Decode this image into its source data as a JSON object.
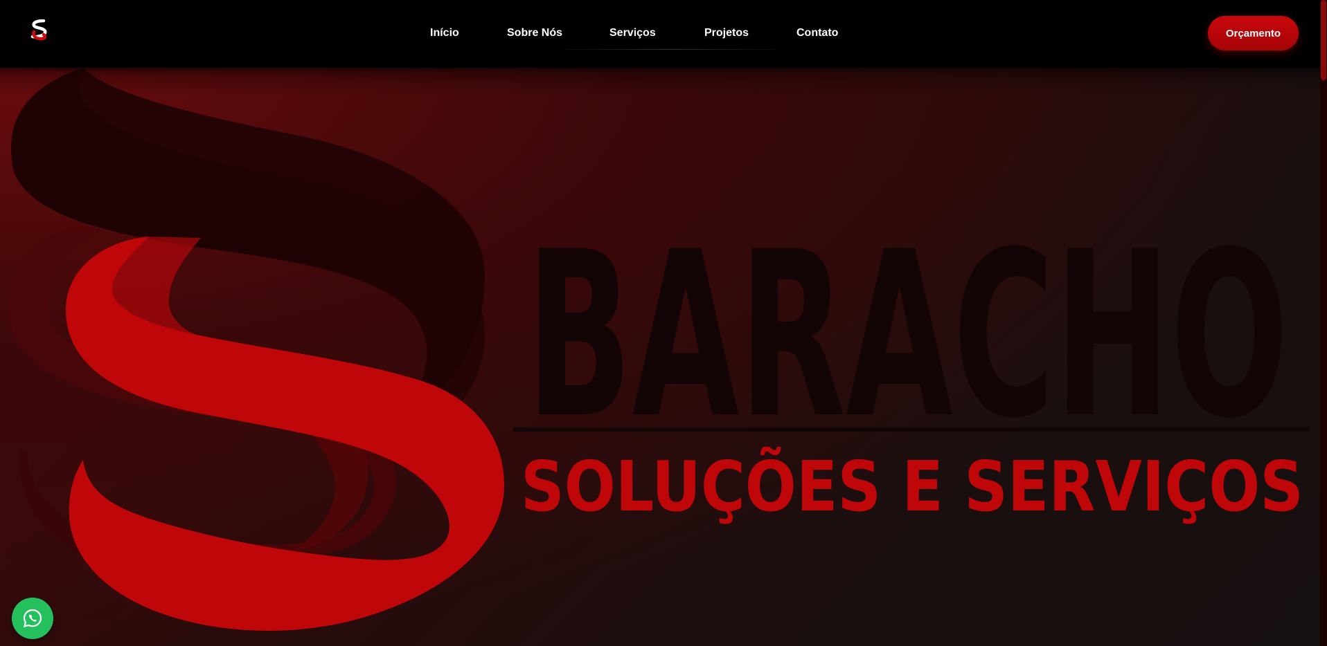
{
  "brand": {
    "name": "BARACHO",
    "tagline": "SOLUÇÕES E SERVIÇOS",
    "logo_icon": "baracho-s-logo-icon",
    "colors": {
      "accent": "#c4070b",
      "dark": "#120606",
      "whatsapp": "#25c05e"
    }
  },
  "nav": {
    "items": [
      {
        "label": "Início"
      },
      {
        "label": "Sobre Nós"
      },
      {
        "label": "Serviços"
      },
      {
        "label": "Projetos"
      },
      {
        "label": "Contato"
      }
    ]
  },
  "header": {
    "cta_label": "Orçamento"
  },
  "floating": {
    "whatsapp_icon": "whatsapp-icon"
  }
}
